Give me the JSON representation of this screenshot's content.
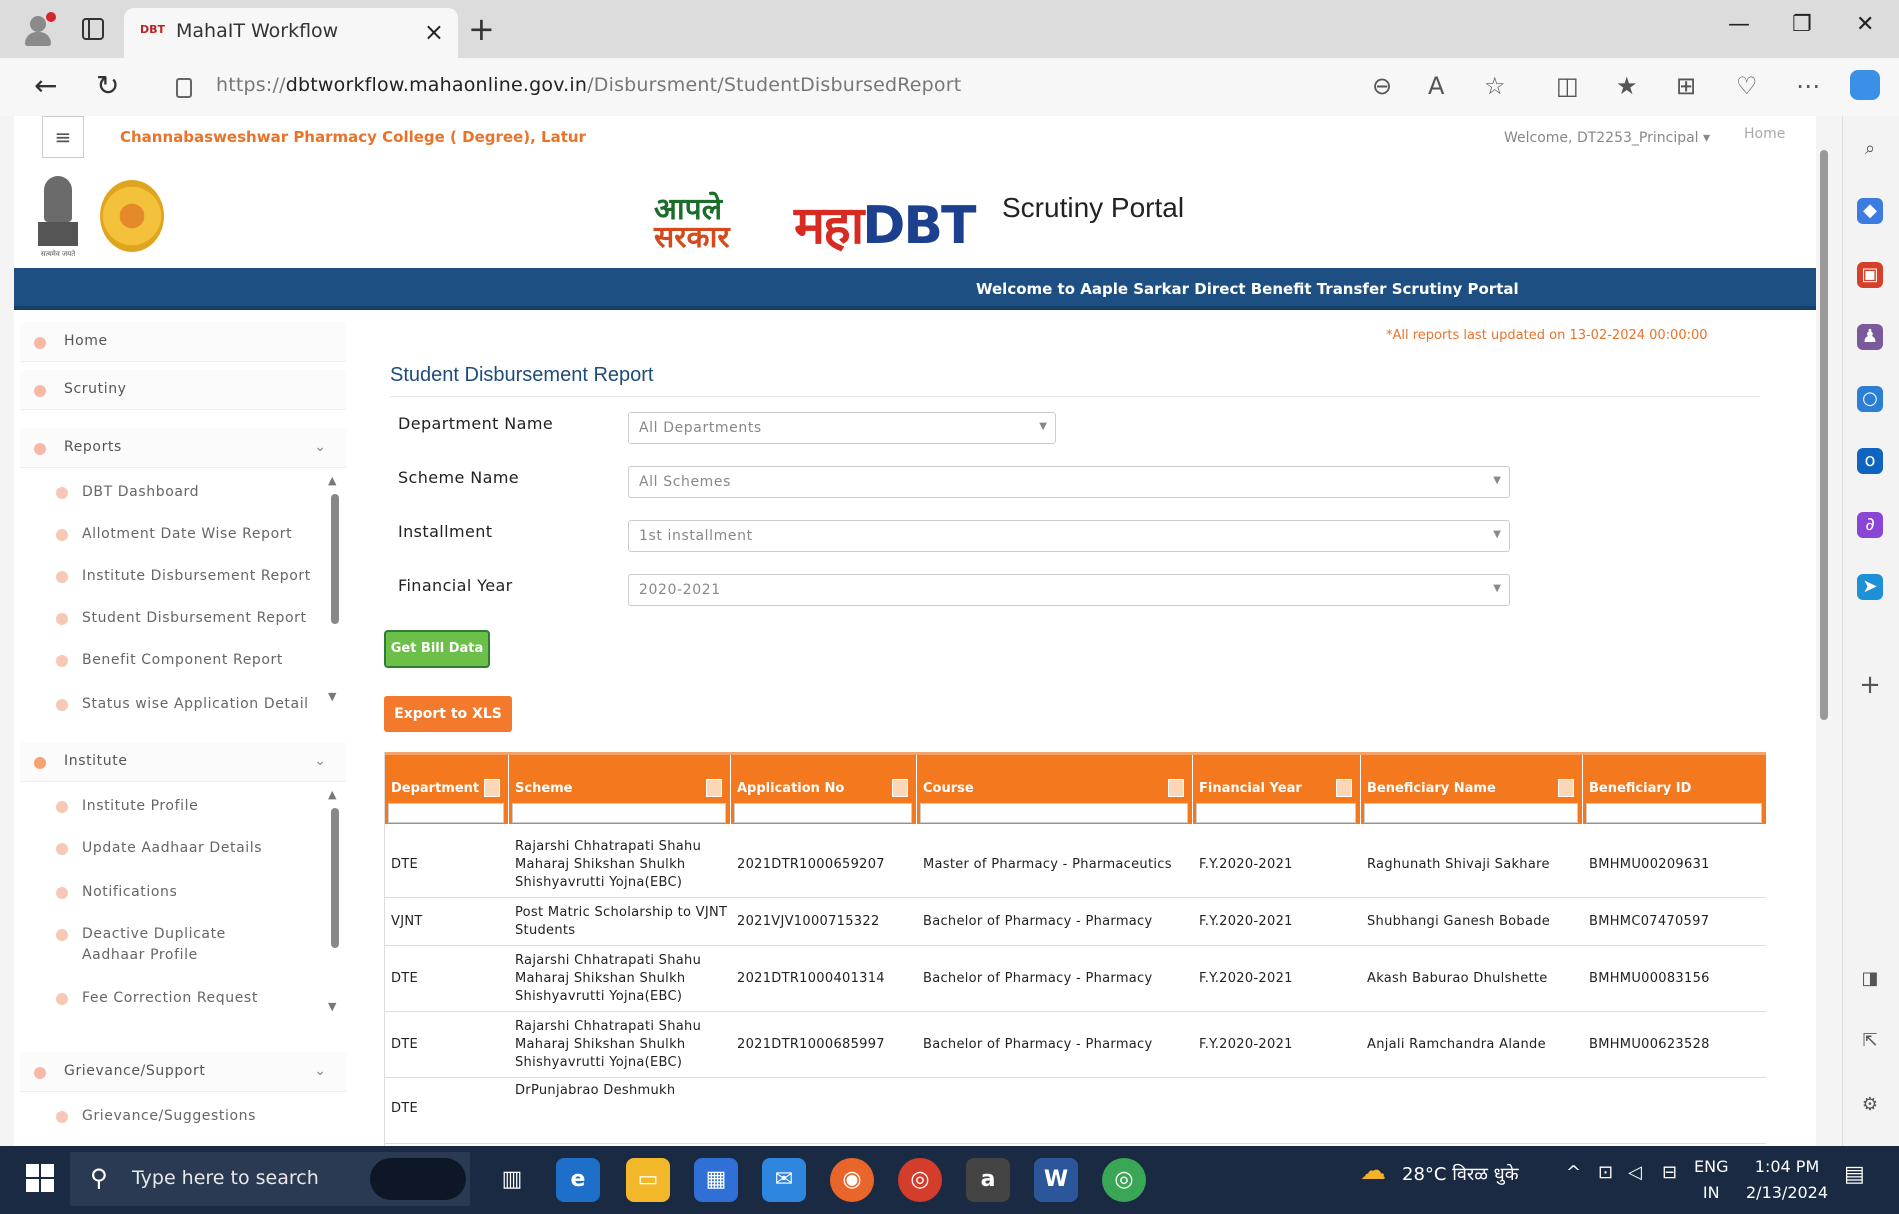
{
  "browser": {
    "tab": {
      "favicon_text": "DBT",
      "title": "MahaIT Workflow"
    },
    "address": {
      "prefix": "https://",
      "domain": "dbtworkflow.mahaonline.gov.in",
      "path": "/Disbursment/StudentDisbursedReport"
    }
  },
  "header": {
    "college_name": "Channabasweshwar Pharmacy College ( Degree), Latur",
    "welcome_user": "Welcome, DT2253_Principal",
    "home_link": "Home",
    "emblem_caption": "सत्यमेव जयते",
    "logo_aaple_top": "आपले",
    "logo_aaple_bottom": "सरकार",
    "logo_maha": "महा",
    "logo_dbt": "DBT",
    "portal_name": "Scrutiny Portal",
    "banner": "Welcome to Aaple Sarkar Direct Benefit Transfer Scrutiny Portal"
  },
  "sidenav": {
    "home": "Home",
    "scrutiny": "Scrutiny",
    "reports": {
      "label": "Reports",
      "items": [
        "DBT Dashboard",
        "Allotment Date Wise Report",
        "Institute Disbursement Report",
        "Student Disbursement Report",
        "Benefit Component Report",
        "Status wise Application Detail"
      ]
    },
    "institute": {
      "label": "Institute",
      "items": [
        "Institute Profile",
        "Update Aadhaar Details",
        "Notifications",
        "Deactive Duplicate Aadhaar Profile",
        "Fee Correction Request"
      ]
    },
    "grievance": {
      "label": "Grievance/Support",
      "items": [
        "Grievance/Suggestions"
      ]
    }
  },
  "report": {
    "last_updated": "*All reports last updated on 13-02-2024 00:00:00",
    "title": "Student Disbursement Report",
    "filters": {
      "department": {
        "label": "Department Name",
        "value": "All Departments"
      },
      "scheme": {
        "label": "Scheme Name",
        "value": "All Schemes"
      },
      "installment": {
        "label": "Installment",
        "value": "1st installment"
      },
      "financial_year": {
        "label": "Financial Year",
        "value": "2020-2021"
      }
    },
    "get_bill_button": "Get Bill Data",
    "export_button": "Export to XLS",
    "columns": [
      "Department",
      "Scheme",
      "Application No",
      "Course",
      "Financial Year",
      "Beneficiary Name",
      "Beneficiary ID"
    ],
    "rows": [
      [
        "DTE",
        "Rajarshi Chhatrapati Shahu Maharaj Shikshan Shulkh Shishyavrutti Yojna(EBC)",
        "2021DTR1000659207",
        "Master of Pharmacy - Pharmaceutics",
        "F.Y.2020-2021",
        "Raghunath Shivaji Sakhare",
        "BMHMU00209631"
      ],
      [
        "VJNT",
        "Post Matric Scholarship to VJNT Students",
        "2021VJV1000715322",
        "Bachelor of Pharmacy - Pharmacy",
        "F.Y.2020-2021",
        "Shubhangi Ganesh Bobade",
        "BMHMC07470597"
      ],
      [
        "DTE",
        "Rajarshi Chhatrapati Shahu Maharaj Shikshan Shulkh Shishyavrutti Yojna(EBC)",
        "2021DTR1000401314",
        "Bachelor of Pharmacy - Pharmacy",
        "F.Y.2020-2021",
        "Akash Baburao Dhulshette",
        "BMHMU00083156"
      ],
      [
        "DTE",
        "Rajarshi Chhatrapati Shahu Maharaj Shikshan Shulkh Shishyavrutti Yojna(EBC)",
        "2021DTR1000685997",
        "Bachelor of Pharmacy - Pharmacy",
        "F.Y.2020-2021",
        "Anjali Ramchandra Alande",
        "BMHMU00623528"
      ],
      [
        "DTE",
        "DrPunjabrao Deshmukh",
        "",
        "",
        "",
        "",
        ""
      ]
    ]
  },
  "taskbar": {
    "search_placeholder": "Type here to search",
    "weather": "28°C  विरळ धुके",
    "language_top": "ENG",
    "language_bottom": "IN",
    "time": "1:04 PM",
    "date": "2/13/2024"
  },
  "colors": {
    "banner": "#1e4f82",
    "grid_header": "#f4781e",
    "college_name": "#e8732a",
    "title": "#1d4c7c",
    "get_bill": "#6cc04a",
    "export": "#f37a2c"
  }
}
